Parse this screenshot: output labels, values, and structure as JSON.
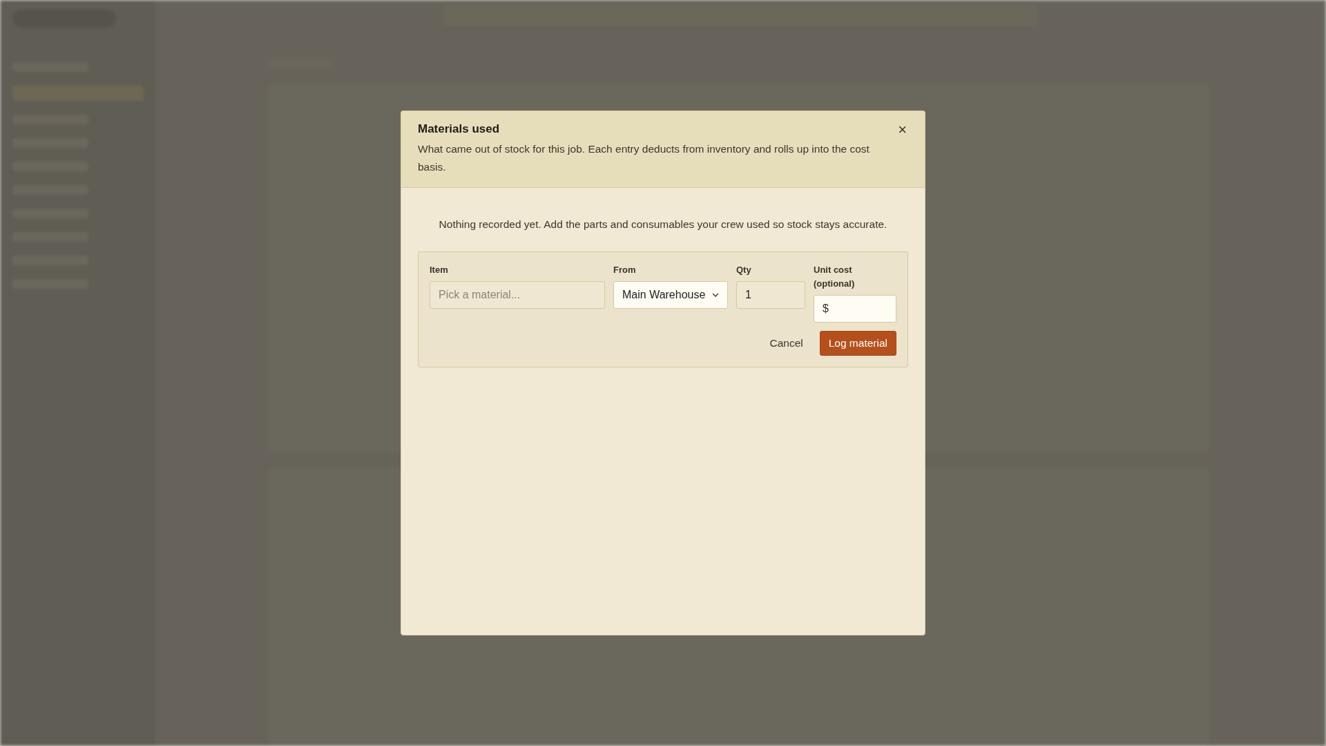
{
  "dialog": {
    "title": "Materials used",
    "close": "×",
    "description": "What came out of stock for this job. Each entry deducts from inventory and rolls up into the cost basis.",
    "empty_message": "Nothing recorded yet. Add the parts and consumables your crew used so stock stays accurate.",
    "form": {
      "fields": [
        {
          "kind": "text",
          "label": "Item",
          "placeholder": "Pick a material..."
        },
        {
          "kind": "select",
          "label": "From",
          "value": "Main Warehouse"
        },
        {
          "kind": "number",
          "label": "Qty",
          "value": "1"
        },
        {
          "kind": "money",
          "label": "Unit cost (optional)",
          "prefix": "$"
        }
      ],
      "buttons": [
        {
          "kind": "secondary",
          "label": "Cancel"
        },
        {
          "kind": "primary",
          "label": "Log material"
        }
      ]
    }
  }
}
